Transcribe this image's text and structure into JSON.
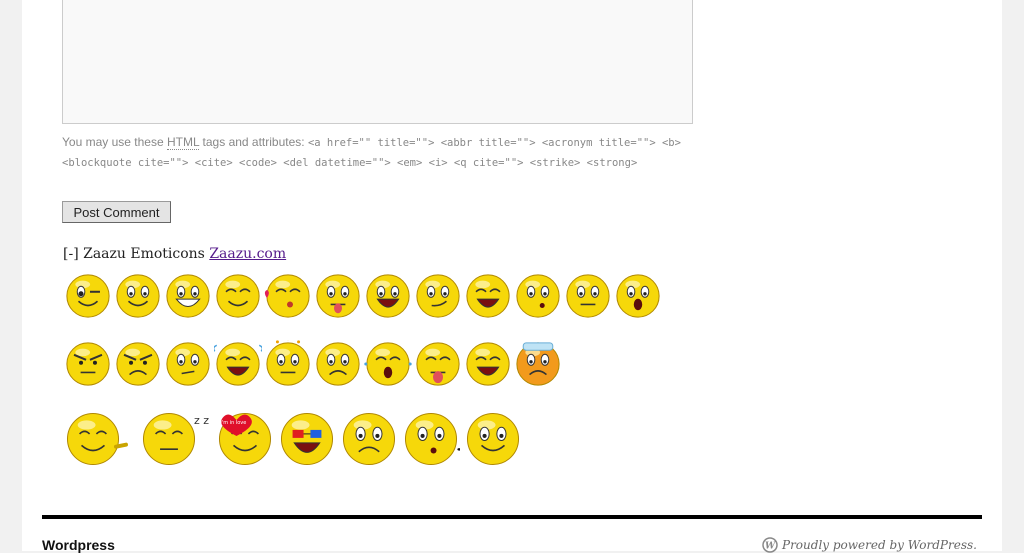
{
  "comment_form": {
    "allowed_tags_intro": "You may use these",
    "allowed_tags_abbr": "HTML",
    "allowed_tags_middle": "tags and attributes:",
    "allowed_tags_code": "<a href=\"\" title=\"\"> <abbr title=\"\"> <acronym title=\"\"> <b> <blockquote cite=\"\"> <cite> <code> <del datetime=\"\"> <em> <i> <q cite=\"\"> <strike> <strong>",
    "submit_label": "Post Comment"
  },
  "emoticons": {
    "toggle": "[-]",
    "title": "Zaazu Emoticons",
    "link": "Zaazu.com",
    "rows": [
      [
        "wink",
        "smile",
        "grin",
        "closed-eyes-smile",
        "blow-kiss",
        "tongue-out",
        "big-grin",
        "smirk",
        "laugh",
        "thinking",
        "unsure",
        "surprised"
      ],
      [
        "angry",
        "mad",
        "skeptical",
        "crying",
        "dizzy",
        "scared",
        "tearful",
        "raspberry",
        "shout",
        "sick"
      ],
      [
        "pointing",
        "sleeping",
        "in-love",
        "3d-glasses-popcorn",
        "worried",
        "whistling",
        "thumbs-up"
      ]
    ],
    "love_text": "i'm in love"
  },
  "footer": {
    "site_title": "Wordpress",
    "powered_by": "Proudly powered by WordPress."
  },
  "colors": {
    "emoticon_yellow": "#f6d80a",
    "emoticon_orange": "#f29a1c",
    "link_purple": "#551a8b"
  }
}
